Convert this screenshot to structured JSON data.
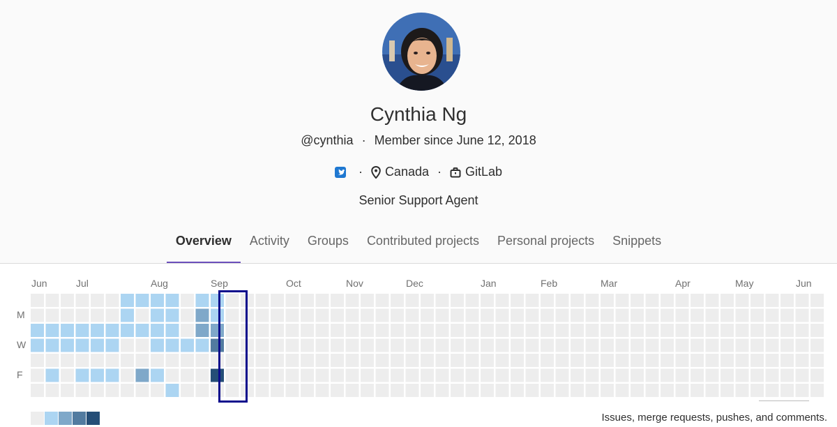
{
  "profile": {
    "name": "Cynthia Ng",
    "username": "@cynthia",
    "member_since": "Member since June 12, 2018",
    "location": "Canada",
    "organization": "GitLab",
    "bio": "Senior Support Agent",
    "separator": "·",
    "icons": {
      "twitter": "twitter-icon",
      "location": "map-marker-icon",
      "organization": "briefcase-icon"
    }
  },
  "tabs": [
    {
      "label": "Overview",
      "active": true
    },
    {
      "label": "Activity",
      "active": false
    },
    {
      "label": "Groups",
      "active": false
    },
    {
      "label": "Contributed projects",
      "active": false
    },
    {
      "label": "Personal projects",
      "active": false
    },
    {
      "label": "Snippets",
      "active": false
    }
  ],
  "calendar": {
    "months": [
      "Jun",
      "Jul",
      "Aug",
      "Sep",
      "Oct",
      "Nov",
      "Dec",
      "Jan",
      "Feb",
      "Mar",
      "Apr",
      "May",
      "Jun"
    ],
    "day_labels": [
      "M",
      "W",
      "F"
    ],
    "legend_text": "Issues, merge requests, pushes, and comments.",
    "colors": [
      "#ededed",
      "#acd5f2",
      "#7fa8c9",
      "#527ba0",
      "#254e77"
    ],
    "activity": [
      "0000001111011000000000000000000000000000000000000000000000000000000",
      "0000001011021000000000000000000000000000000000000000000000000000000",
      "1111111111022000000000000000000000000000000000000000000000000000000",
      "1111110011113000000000000000000000000000000000000000000000000000000",
      "0000000000000000000000000000000000000000000000000000000000000000000",
      "0101110210004000000000000000000000000000000000000000000000000000000",
      "0000000001000000000000000000000000000000000000000000000000000000000"
    ]
  }
}
